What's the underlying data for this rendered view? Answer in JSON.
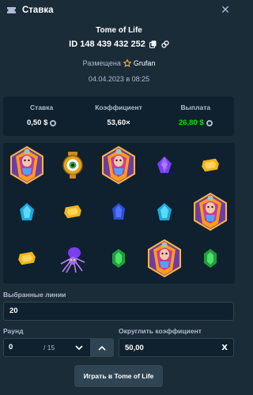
{
  "header": {
    "title": "Ставка",
    "close_label": "✕"
  },
  "bet": {
    "game": "Tome of Life",
    "id": "ID 148 439 432 252",
    "placed_label": "Размещена",
    "user": "Grufan",
    "date": "04.04.2023 в 08:25"
  },
  "stats": {
    "bet_label": "Ставка",
    "bet_value": "0,50 $",
    "coef_label": "Коэффициент",
    "coef_value": "53,60×",
    "payout_label": "Выплата",
    "payout_value": "26,80 $"
  },
  "reels": [
    [
      "pharaoh",
      "eye-amulet",
      "pharaoh",
      "purple-gem",
      "yellow-gem"
    ],
    [
      "cyan-gem",
      "yellow-gem",
      "blue-gem",
      "cyan-gem",
      "pharaoh"
    ],
    [
      "yellow-gem",
      "spider",
      "green-gem",
      "pharaoh",
      "green-gem"
    ]
  ],
  "controls": {
    "lines_label": "Выбранные линии",
    "lines_value": "20",
    "round_label": "Раунд",
    "round_value": "0",
    "round_total": "/ 15",
    "coef_label": "Округлить коэффициент",
    "coef_value": "50,00",
    "coef_clear": "X",
    "play_label": "Играть в Tome of Life"
  },
  "colors": {
    "background": "#1a2c38",
    "panel": "#0f212e",
    "accent_green": "#00e701",
    "muted_text": "#b1bad3",
    "star": "#ffb547"
  }
}
